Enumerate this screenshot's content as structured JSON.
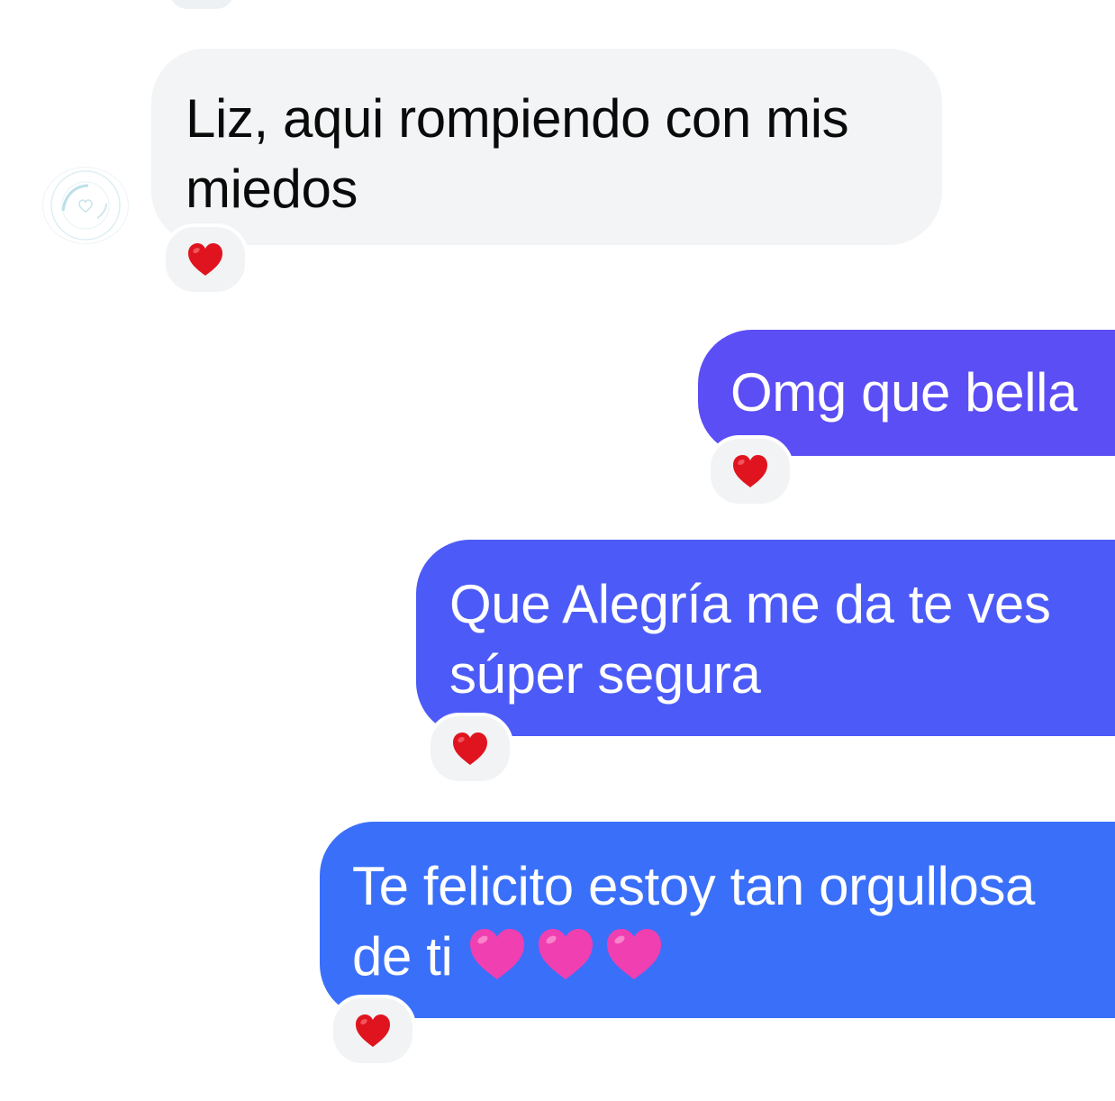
{
  "chat": {
    "messages": [
      {
        "direction": "incoming",
        "text": "Liz, aqui rompiendo con mis miedos",
        "reaction": "red-heart",
        "line1": "Liz, aqui rompiendo con mis",
        "line2": "miedos"
      },
      {
        "direction": "outgoing",
        "text": "Omg que bella",
        "reaction": "red-heart"
      },
      {
        "direction": "outgoing",
        "text": "Que Alegría me da te ves súper segura",
        "reaction": "red-heart",
        "line1": "Que Alegría me da te ves",
        "line2": "súper segura"
      },
      {
        "direction": "outgoing",
        "text": "Te felicito estoy tan orgullosa de ti",
        "emojis": [
          "pink-heart",
          "pink-heart",
          "pink-heart"
        ],
        "reaction": "red-heart",
        "line1": "Te felicito estoy tan orgullosa",
        "line2": "de ti "
      }
    ]
  },
  "colors": {
    "incoming_bubble": "#f2f4f5",
    "outgoing_gradient": [
      "#5b4ef5",
      "#4c5bf7",
      "#3a6ff9"
    ],
    "reaction_heart": "#e0141f",
    "pink_heart": "#f03fb0"
  }
}
